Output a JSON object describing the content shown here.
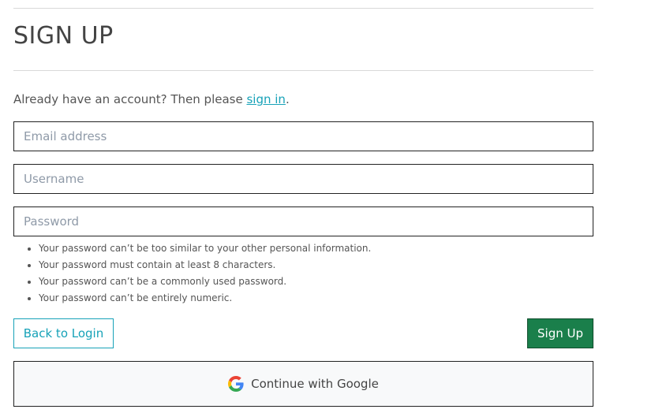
{
  "page": {
    "title": "SIGN UP"
  },
  "signin_prompt": {
    "prefix": "Already have an account? Then please ",
    "link": "sign in",
    "suffix": "."
  },
  "form": {
    "email_placeholder": "Email address",
    "email_value": "",
    "username_placeholder": "Username",
    "username_value": "",
    "password_placeholder": "Password",
    "password_value": ""
  },
  "password_help": [
    "Your password can’t be too similar to your other personal information.",
    "Your password must contain at least 8 characters.",
    "Your password can’t be a commonly used password.",
    "Your password can’t be entirely numeric."
  ],
  "buttons": {
    "back_label": "Back to Login",
    "signup_label": "Sign Up",
    "google_label": "Continue with Google"
  },
  "icons": {
    "google": "google-icon"
  },
  "colors": {
    "link": "#17a2b8",
    "primary": "#1a7f4b"
  }
}
